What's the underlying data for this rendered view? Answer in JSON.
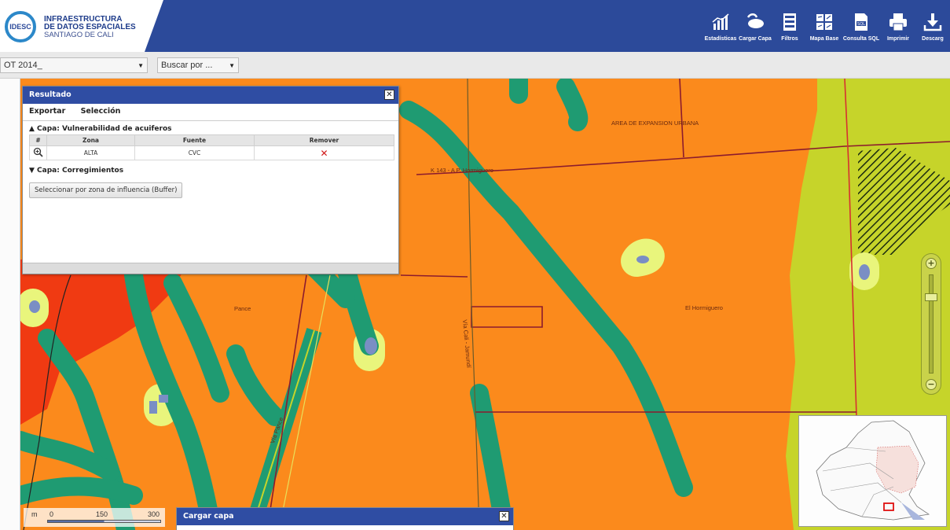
{
  "app": {
    "logo_badge": "IDESC",
    "logo_line1": "INFRAESTRUCTURA",
    "logo_line2": "DE DATOS ESPACIALES",
    "logo_line3": "SANTIAGO DE CALI"
  },
  "toolbar": {
    "items": [
      {
        "label": "Estadísticas",
        "icon": "bar-chart-icon"
      },
      {
        "label": "Cargar Capa",
        "icon": "load-layer-icon"
      },
      {
        "label": "Filtros",
        "icon": "filter-icon"
      },
      {
        "label": "Mapa Base",
        "icon": "basemap-icon"
      },
      {
        "label": "Consulta SQL",
        "icon": "sql-icon"
      },
      {
        "label": "Imprimir",
        "icon": "print-icon"
      },
      {
        "label": "Descarg",
        "icon": "download-icon"
      }
    ]
  },
  "filters": {
    "year_value": "OT 2014_",
    "search_value": "Buscar por ..."
  },
  "results_panel": {
    "title": "Resultado",
    "menu": [
      "Exportar",
      "Selección"
    ],
    "layer1_title": "▲ Capa: Vulnerabilidad de acuiferos",
    "table_headers": [
      "#",
      "Zona",
      "Fuente",
      "Remover"
    ],
    "table_rows": [
      {
        "zona": "ALTA",
        "fuente": "CVC"
      }
    ],
    "layer2_title": "▼ Capa: Corregimientos",
    "buffer_button": "Seleccionar por zona de influencia (Buffer)"
  },
  "cargar_panel": {
    "title": "Cargar capa"
  },
  "map_labels": {
    "expansion": "AREA DE EXPANSION URBANA",
    "road1": "K 143 - A P. Hormiguero",
    "road2": "Vía Cali - Jamundí",
    "road3": "Vía Pance",
    "place1": "Pance",
    "place2": "El Hormiguero"
  },
  "scale": {
    "unit": "m",
    "ticks": [
      "0",
      "150",
      "300"
    ]
  },
  "colors": {
    "header_blue": "#2c4a9a",
    "zone_orange": "#fb8a1c",
    "zone_red": "#f03a12",
    "zone_lime": "#c6d42a",
    "channel_green": "#1f9b72",
    "buffer_yellow": "#e9f57c",
    "water_blue": "#7a8ec4"
  }
}
